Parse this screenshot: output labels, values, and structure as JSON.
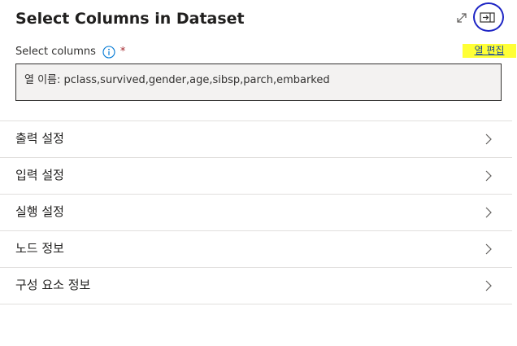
{
  "panel": {
    "title": "Select Columns in Dataset",
    "expand_icon": "expand-diagonal-icon",
    "collapse_icon": "collapse-panel-icon"
  },
  "field": {
    "label": "Select columns",
    "required_mark": "*",
    "info_icon": "info-icon",
    "edit_link": "열 편집",
    "value": "열 이름: pclass,survived,gender,age,sibsp,parch,embarked"
  },
  "sections": [
    {
      "label": "출력 설정"
    },
    {
      "label": "입력 설정"
    },
    {
      "label": "실행 설정"
    },
    {
      "label": "노드 정보"
    },
    {
      "label": "구성 요소 정보"
    }
  ],
  "colors": {
    "highlight": "#ffff35",
    "annotation_circle": "#1d24c4",
    "required": "#a4262c",
    "input_background": "#f3f2f1"
  }
}
